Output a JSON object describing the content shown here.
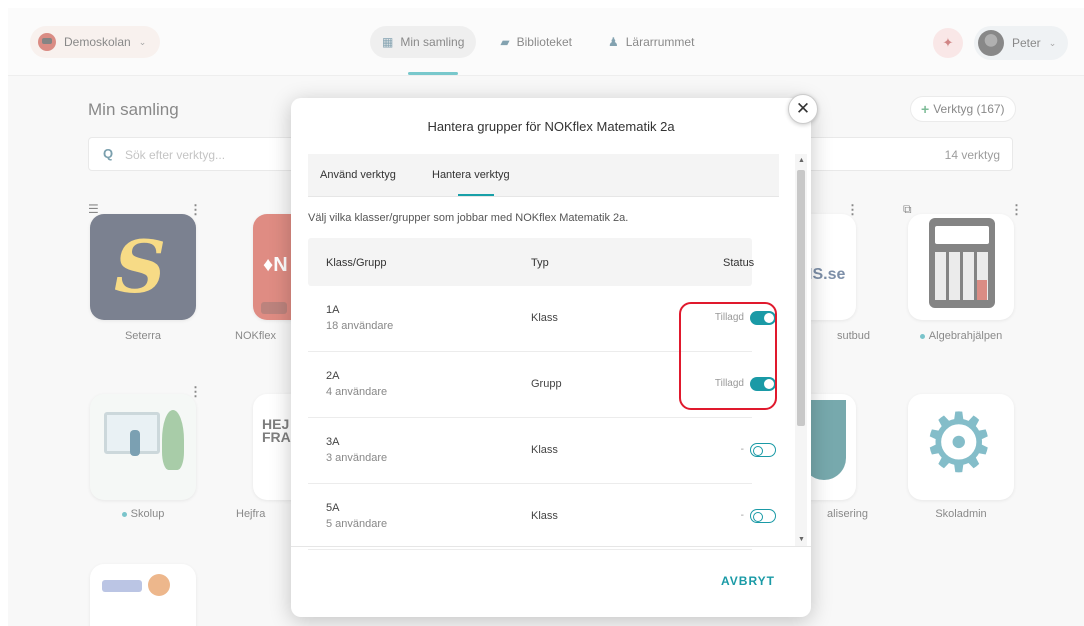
{
  "header": {
    "school": "Demoskolan",
    "nav": [
      "Min samling",
      "Biblioteket",
      "Lärarrummet"
    ],
    "user": "Peter"
  },
  "collection": {
    "title": "Min samling",
    "add_tools": "Verktyg (167)",
    "search_placeholder": "Sök efter verktyg...",
    "tool_count": "14 verktyg",
    "tiles": [
      {
        "label": "Seterra",
        "dot": false
      },
      {
        "label": "NOKflex",
        "dot": false
      },
      {
        "label": "sutbud",
        "dot": false
      },
      {
        "label": "Algebrahjälpen",
        "dot": true
      },
      {
        "label": "Skolup",
        "dot": true
      },
      {
        "label": "Hejfra",
        "dot": false
      },
      {
        "label": "alisering",
        "dot": false
      },
      {
        "label": "Skoladmin",
        "dot": false
      }
    ],
    "hej_text_1": "HEJ",
    "hej_text_2": "FRAM",
    "is_text": "IS.se"
  },
  "modal": {
    "title": "Hantera grupper för NOKflex Matematik 2a",
    "tabs": [
      "Använd verktyg",
      "Hantera verktyg"
    ],
    "active_tab": "Hantera verktyg",
    "description": "Välj vilka klasser/grupper som jobbar med NOKflex Matematik 2a.",
    "columns": [
      "Klass/Grupp",
      "Typ",
      "Status"
    ],
    "rows": [
      {
        "name": "1A",
        "users": "18 användare",
        "type": "Klass",
        "status": "Tillagd",
        "enabled": true
      },
      {
        "name": "2A",
        "users": "4 användare",
        "type": "Grupp",
        "status": "Tillagd",
        "enabled": true
      },
      {
        "name": "3A",
        "users": "3 användare",
        "type": "Klass",
        "status": "-",
        "enabled": false
      },
      {
        "name": "5A",
        "users": "5 användare",
        "type": "Klass",
        "status": "-",
        "enabled": false
      }
    ],
    "cancel": "AVBRYT"
  },
  "colors": {
    "accent": "#1a9aa6",
    "highlight": "#e0192d"
  }
}
